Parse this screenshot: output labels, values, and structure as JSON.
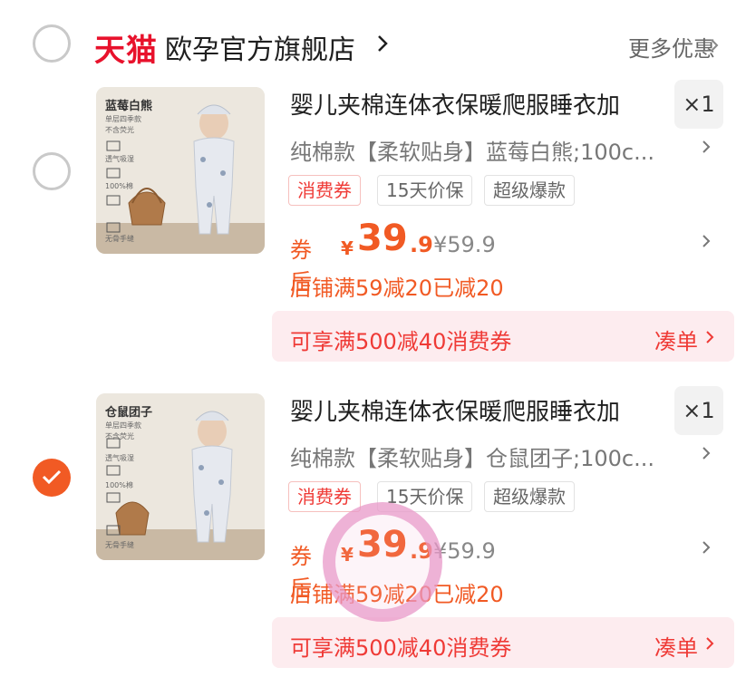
{
  "store": {
    "platform_logo": "天猫",
    "name": "欧孕官方旗舰店",
    "more_offers_label": "更多优惠",
    "selected": false
  },
  "items": [
    {
      "selected": false,
      "thumbnail_label": "蓝莓白熊",
      "thumbnail_features": [
        "单层四季款",
        "不含荧光",
        "透气吸湿",
        "100%棉",
        "无骨手缝"
      ],
      "title": "婴儿夹棉连体衣保暖爬服睡衣加",
      "quantity": "×1",
      "spec": "纯棉款【柔软贴身】蓝莓白熊;100c...",
      "tags": [
        "消费券",
        "15天价保",
        "超级爆款"
      ],
      "price_prefix": "券后",
      "currency": "¥",
      "price_int": "39",
      "price_dec": ".9",
      "original_price": "¥59.9",
      "discount_text": "店铺满59减20已减20",
      "coupon_banner": "可享满500减40消费券",
      "coupon_action": "凑单"
    },
    {
      "selected": true,
      "thumbnail_label": "仓鼠团子",
      "thumbnail_features": [
        "单层四季款",
        "不含荧光",
        "透气吸湿",
        "100%棉",
        "无骨手缝"
      ],
      "title": "婴儿夹棉连体衣保暖爬服睡衣加",
      "quantity": "×1",
      "spec": "纯棉款【柔软贴身】仓鼠团子;100c...",
      "tags": [
        "消费券",
        "15天价保",
        "超级爆款"
      ],
      "price_prefix": "券后",
      "currency": "¥",
      "price_int": "39",
      "price_dec": ".9",
      "original_price": "¥59.9",
      "discount_text": "店铺满59减20已减20",
      "coupon_banner": "可享满500减40消费券",
      "coupon_action": "凑单"
    }
  ],
  "colors": {
    "tmall_red": "#e8122c",
    "accent_orange": "#f15a24",
    "coupon_red": "#ef3a36",
    "banner_bg": "#fdecef",
    "touch_ring": "#e896c8"
  }
}
